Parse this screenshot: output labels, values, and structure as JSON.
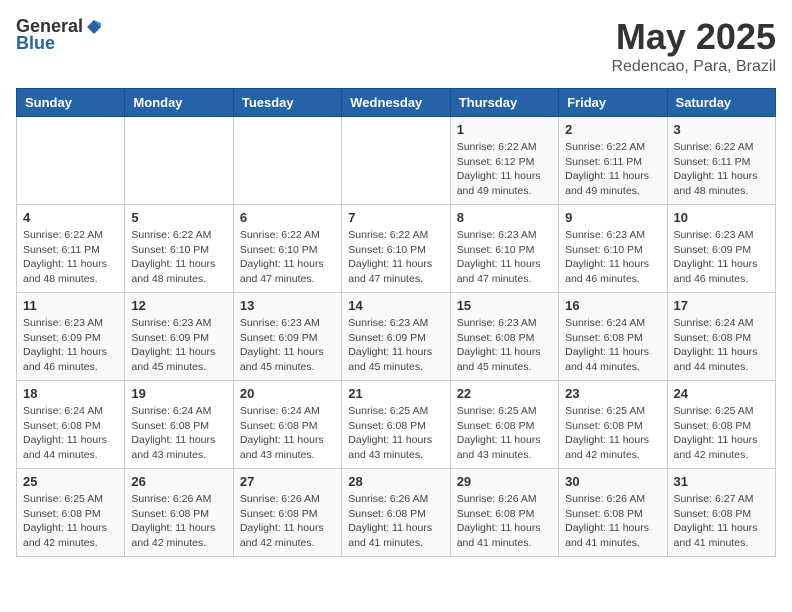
{
  "header": {
    "logo_general": "General",
    "logo_blue": "Blue",
    "title": "May 2025",
    "location": "Redencao, Para, Brazil"
  },
  "weekdays": [
    "Sunday",
    "Monday",
    "Tuesday",
    "Wednesday",
    "Thursday",
    "Friday",
    "Saturday"
  ],
  "weeks": [
    [
      {
        "day": "",
        "info": ""
      },
      {
        "day": "",
        "info": ""
      },
      {
        "day": "",
        "info": ""
      },
      {
        "day": "",
        "info": ""
      },
      {
        "day": "1",
        "info": "Sunrise: 6:22 AM\nSunset: 6:12 PM\nDaylight: 11 hours\nand 49 minutes."
      },
      {
        "day": "2",
        "info": "Sunrise: 6:22 AM\nSunset: 6:11 PM\nDaylight: 11 hours\nand 49 minutes."
      },
      {
        "day": "3",
        "info": "Sunrise: 6:22 AM\nSunset: 6:11 PM\nDaylight: 11 hours\nand 48 minutes."
      }
    ],
    [
      {
        "day": "4",
        "info": "Sunrise: 6:22 AM\nSunset: 6:11 PM\nDaylight: 11 hours\nand 48 minutes."
      },
      {
        "day": "5",
        "info": "Sunrise: 6:22 AM\nSunset: 6:10 PM\nDaylight: 11 hours\nand 48 minutes."
      },
      {
        "day": "6",
        "info": "Sunrise: 6:22 AM\nSunset: 6:10 PM\nDaylight: 11 hours\nand 47 minutes."
      },
      {
        "day": "7",
        "info": "Sunrise: 6:22 AM\nSunset: 6:10 PM\nDaylight: 11 hours\nand 47 minutes."
      },
      {
        "day": "8",
        "info": "Sunrise: 6:23 AM\nSunset: 6:10 PM\nDaylight: 11 hours\nand 47 minutes."
      },
      {
        "day": "9",
        "info": "Sunrise: 6:23 AM\nSunset: 6:10 PM\nDaylight: 11 hours\nand 46 minutes."
      },
      {
        "day": "10",
        "info": "Sunrise: 6:23 AM\nSunset: 6:09 PM\nDaylight: 11 hours\nand 46 minutes."
      }
    ],
    [
      {
        "day": "11",
        "info": "Sunrise: 6:23 AM\nSunset: 6:09 PM\nDaylight: 11 hours\nand 46 minutes."
      },
      {
        "day": "12",
        "info": "Sunrise: 6:23 AM\nSunset: 6:09 PM\nDaylight: 11 hours\nand 45 minutes."
      },
      {
        "day": "13",
        "info": "Sunrise: 6:23 AM\nSunset: 6:09 PM\nDaylight: 11 hours\nand 45 minutes."
      },
      {
        "day": "14",
        "info": "Sunrise: 6:23 AM\nSunset: 6:09 PM\nDaylight: 11 hours\nand 45 minutes."
      },
      {
        "day": "15",
        "info": "Sunrise: 6:23 AM\nSunset: 6:08 PM\nDaylight: 11 hours\nand 45 minutes."
      },
      {
        "day": "16",
        "info": "Sunrise: 6:24 AM\nSunset: 6:08 PM\nDaylight: 11 hours\nand 44 minutes."
      },
      {
        "day": "17",
        "info": "Sunrise: 6:24 AM\nSunset: 6:08 PM\nDaylight: 11 hours\nand 44 minutes."
      }
    ],
    [
      {
        "day": "18",
        "info": "Sunrise: 6:24 AM\nSunset: 6:08 PM\nDaylight: 11 hours\nand 44 minutes."
      },
      {
        "day": "19",
        "info": "Sunrise: 6:24 AM\nSunset: 6:08 PM\nDaylight: 11 hours\nand 43 minutes."
      },
      {
        "day": "20",
        "info": "Sunrise: 6:24 AM\nSunset: 6:08 PM\nDaylight: 11 hours\nand 43 minutes."
      },
      {
        "day": "21",
        "info": "Sunrise: 6:25 AM\nSunset: 6:08 PM\nDaylight: 11 hours\nand 43 minutes."
      },
      {
        "day": "22",
        "info": "Sunrise: 6:25 AM\nSunset: 6:08 PM\nDaylight: 11 hours\nand 43 minutes."
      },
      {
        "day": "23",
        "info": "Sunrise: 6:25 AM\nSunset: 6:08 PM\nDaylight: 11 hours\nand 42 minutes."
      },
      {
        "day": "24",
        "info": "Sunrise: 6:25 AM\nSunset: 6:08 PM\nDaylight: 11 hours\nand 42 minutes."
      }
    ],
    [
      {
        "day": "25",
        "info": "Sunrise: 6:25 AM\nSunset: 6:08 PM\nDaylight: 11 hours\nand 42 minutes."
      },
      {
        "day": "26",
        "info": "Sunrise: 6:26 AM\nSunset: 6:08 PM\nDaylight: 11 hours\nand 42 minutes."
      },
      {
        "day": "27",
        "info": "Sunrise: 6:26 AM\nSunset: 6:08 PM\nDaylight: 11 hours\nand 42 minutes."
      },
      {
        "day": "28",
        "info": "Sunrise: 6:26 AM\nSunset: 6:08 PM\nDaylight: 11 hours\nand 41 minutes."
      },
      {
        "day": "29",
        "info": "Sunrise: 6:26 AM\nSunset: 6:08 PM\nDaylight: 11 hours\nand 41 minutes."
      },
      {
        "day": "30",
        "info": "Sunrise: 6:26 AM\nSunset: 6:08 PM\nDaylight: 11 hours\nand 41 minutes."
      },
      {
        "day": "31",
        "info": "Sunrise: 6:27 AM\nSunset: 6:08 PM\nDaylight: 11 hours\nand 41 minutes."
      }
    ]
  ]
}
